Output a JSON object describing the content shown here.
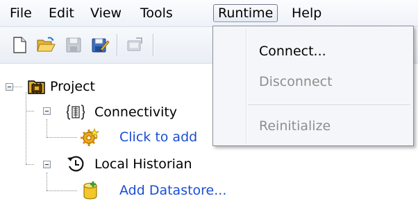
{
  "menubar": {
    "items": [
      {
        "label": "File"
      },
      {
        "label": "Edit"
      },
      {
        "label": "View"
      },
      {
        "label": "Tools"
      },
      {
        "label": "Runtime"
      },
      {
        "label": "Help"
      }
    ]
  },
  "toolbar": {
    "buttons": [
      "new-document-icon",
      "open-folder-icon",
      "save-icon",
      "save-as-icon",
      "deploy-icon"
    ]
  },
  "tree": {
    "project": {
      "label": "Project",
      "icon": "project-icon"
    },
    "connectivity": {
      "label": "Connectivity",
      "icon": "connectivity-icon"
    },
    "click_to_add": {
      "label": "Click to add",
      "icon": "gear-star-icon"
    },
    "local_historian": {
      "label": "Local Historian",
      "icon": "historian-clock-icon"
    },
    "add_datastore": {
      "label": "Add Datastore...",
      "icon": "datastore-icon"
    }
  },
  "runtime_menu": {
    "items": [
      {
        "label": "Connect...",
        "enabled": true
      },
      {
        "label": "Disconnect",
        "enabled": false
      },
      {
        "label": "Reinitialize",
        "enabled": false
      }
    ]
  },
  "colors": {
    "link": "#1a4dd8",
    "disabled_text": "#8e8e8e",
    "menu_bg": "#f4f6f9"
  }
}
